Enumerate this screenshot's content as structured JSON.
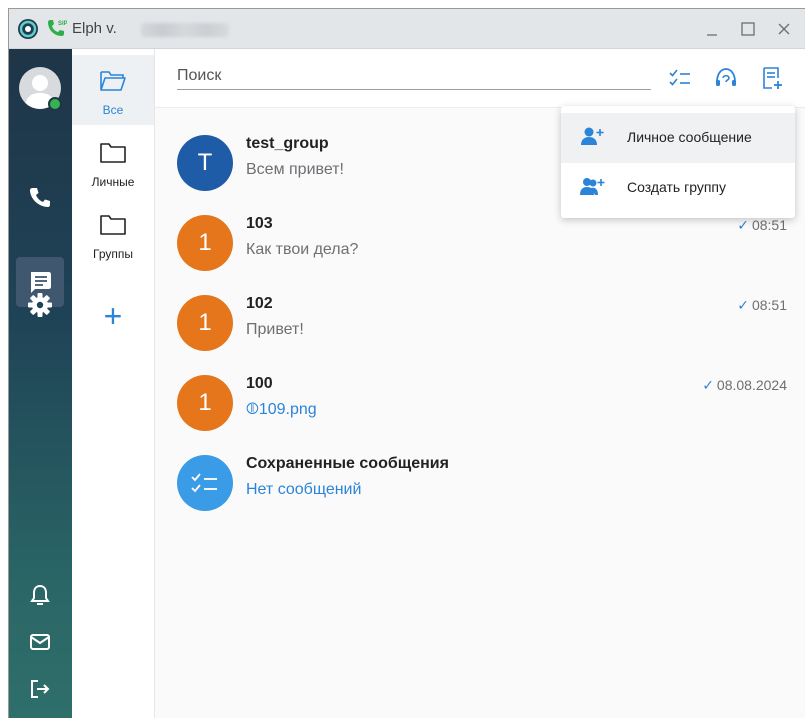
{
  "titlebar": {
    "app_title": "Elph v.",
    "buttons": {
      "minimize": "_",
      "maximize": "☐",
      "close": "×"
    }
  },
  "rail": {
    "items": [
      {
        "icon": "phone-icon"
      },
      {
        "icon": "chat-icon",
        "active": true
      },
      {
        "icon": "gear-icon"
      },
      {
        "icon": "bell-icon"
      },
      {
        "icon": "mail-icon"
      },
      {
        "icon": "logout-icon"
      }
    ],
    "status_color": "#36b34f"
  },
  "folders": {
    "items": [
      {
        "label": "Все",
        "active": true
      },
      {
        "label": "Личные"
      },
      {
        "label": "Группы"
      }
    ],
    "add_label": "+"
  },
  "search": {
    "placeholder": "Поиск",
    "value": ""
  },
  "header_icons": [
    "checklist-icon",
    "support-icon",
    "new-chat-icon"
  ],
  "chats": [
    {
      "avatar": "T",
      "avatar_color": "#1f5ca8",
      "name": "test_group",
      "message": "Всем привет!",
      "time": "",
      "read": false,
      "link": false
    },
    {
      "avatar": "1",
      "avatar_color": "#e5761c",
      "name": "103",
      "message": "Как твои дела?",
      "time": "08:51",
      "read": true,
      "link": false
    },
    {
      "avatar": "1",
      "avatar_color": "#e5761c",
      "name": "102",
      "message": "Привет!",
      "time": "08:51",
      "read": true,
      "link": false
    },
    {
      "avatar": "1",
      "avatar_color": "#e5761c",
      "name": "100",
      "message": "109.png",
      "time": "08.08.2024",
      "read": true,
      "link": true
    },
    {
      "avatar": "",
      "avatar_color": "#3a9be6",
      "name": "Сохраненные сообщения",
      "message": "Нет сообщений",
      "time": "",
      "read": false,
      "link": true
    }
  ],
  "dropdown": {
    "items": [
      {
        "label": "Личное сообщение",
        "icon": "add-person-icon"
      },
      {
        "label": "Создать группу",
        "icon": "add-group-icon"
      }
    ]
  },
  "colors": {
    "accent": "#2b84d8",
    "rail_top": "#1f3548",
    "rail_bottom": "#2f6f6a"
  }
}
